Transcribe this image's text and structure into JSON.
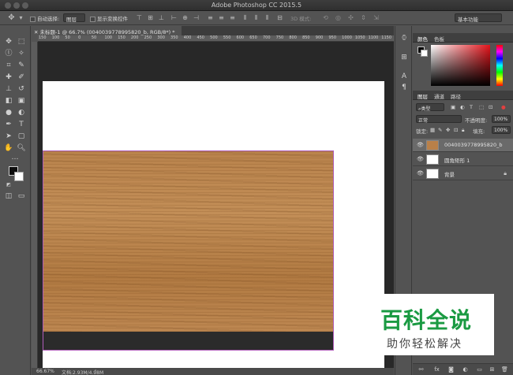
{
  "window": {
    "title": "Adobe Photoshop CC 2015.5"
  },
  "options_bar": {
    "move_icon": "move-icon",
    "auto_select_label": "自动选择:",
    "auto_select_value": "图层",
    "show_transform_label": "显示变换控件",
    "mode_3d_label": "3D 模式:",
    "workspace": "基本功能"
  },
  "document": {
    "tab_title": "未标题-1 @ 66.7% (0040039778995820_b, RGB/8*) *",
    "ruler_ticks": [
      "150",
      "100",
      "50",
      "0",
      "50",
      "100",
      "150",
      "200",
      "250",
      "300",
      "350",
      "400",
      "450",
      "500",
      "550",
      "600",
      "650",
      "700",
      "750",
      "800",
      "850",
      "900",
      "950",
      "1000",
      "1050",
      "1100",
      "1150"
    ]
  },
  "status": {
    "zoom": "66.67%",
    "doc_info": "文档:2.93M/4.98M"
  },
  "colors": {
    "shape_outline": "#b05dbb",
    "foreground": "#0d0d0d",
    "background": "#ffffff"
  },
  "panels": {
    "color_tabs": [
      "颜色",
      "色板"
    ],
    "layers_tabs": [
      "图层",
      "通道",
      "路径"
    ],
    "filter_kind": "类型",
    "blend_mode": "正常",
    "opacity_label": "不透明度:",
    "opacity_value": "100%",
    "lock_label": "锁定:",
    "fill_label": "填充:",
    "fill_value": "100%",
    "layers": [
      {
        "name": "0040039778995820_b",
        "selected": true
      },
      {
        "name": "圆角矩形 1",
        "selected": false
      },
      {
        "name": "背景",
        "selected": false
      }
    ]
  },
  "watermark": {
    "main": "百科全说",
    "sub": "助你轻松解决"
  }
}
